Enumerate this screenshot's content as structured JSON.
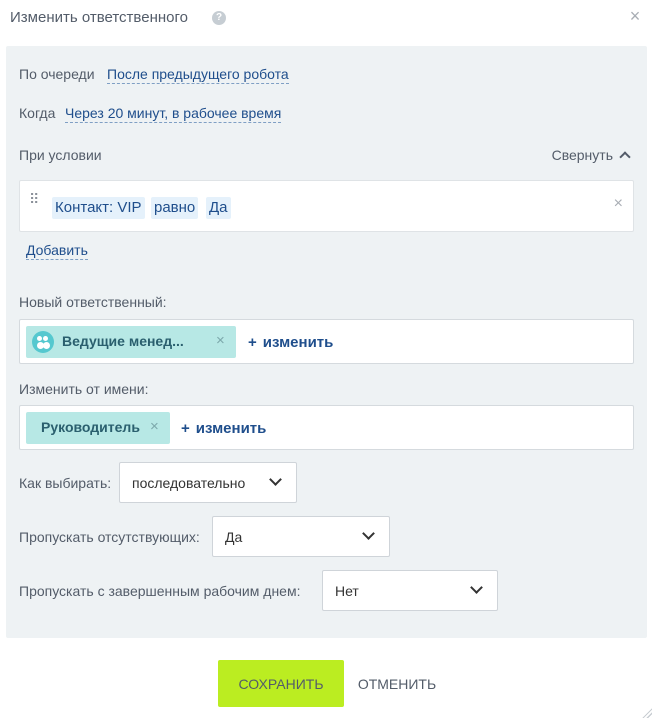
{
  "dialog": {
    "title": "Изменить ответственного",
    "help_glyph": "?",
    "close_glyph": "×"
  },
  "queue": {
    "label": "По очереди",
    "value": "После предыдущего робота"
  },
  "when": {
    "label": "Когда",
    "value": "Через 20 минут, в рабочее время"
  },
  "condition": {
    "label": "При условии",
    "collapse_label": "Свернуть",
    "field": "Контакт: VIP",
    "operator": "равно",
    "value": "Да",
    "remove_glyph": "×",
    "drag_glyph": "⠿",
    "add_label": "Добавить"
  },
  "new_responsible": {
    "label": "Новый ответственный:",
    "tag": "Ведущие менед...",
    "tag_remove_glyph": "×",
    "change_plus": "+",
    "change_label": "изменить"
  },
  "change_from": {
    "label": "Изменить от имени:",
    "tag": "Руководитель",
    "tag_remove_glyph": "×",
    "change_plus": "+",
    "change_label": "изменить"
  },
  "how_choose": {
    "label": "Как выбирать:",
    "value": "последовательно"
  },
  "skip_absent": {
    "label": "Пропускать отсутствующих:",
    "value": "Да"
  },
  "skip_finished": {
    "label": "Пропускать с завершенным рабочим днем:",
    "value": "Нет"
  },
  "buttons": {
    "save": "СОХРАНИТЬ",
    "cancel": "ОТМЕНИТЬ"
  },
  "colors": {
    "save_bg": "#bbed21",
    "tag_bg": "#b7e8e5",
    "link": "#1f4e8c",
    "panel_bg": "#eef2f4"
  }
}
